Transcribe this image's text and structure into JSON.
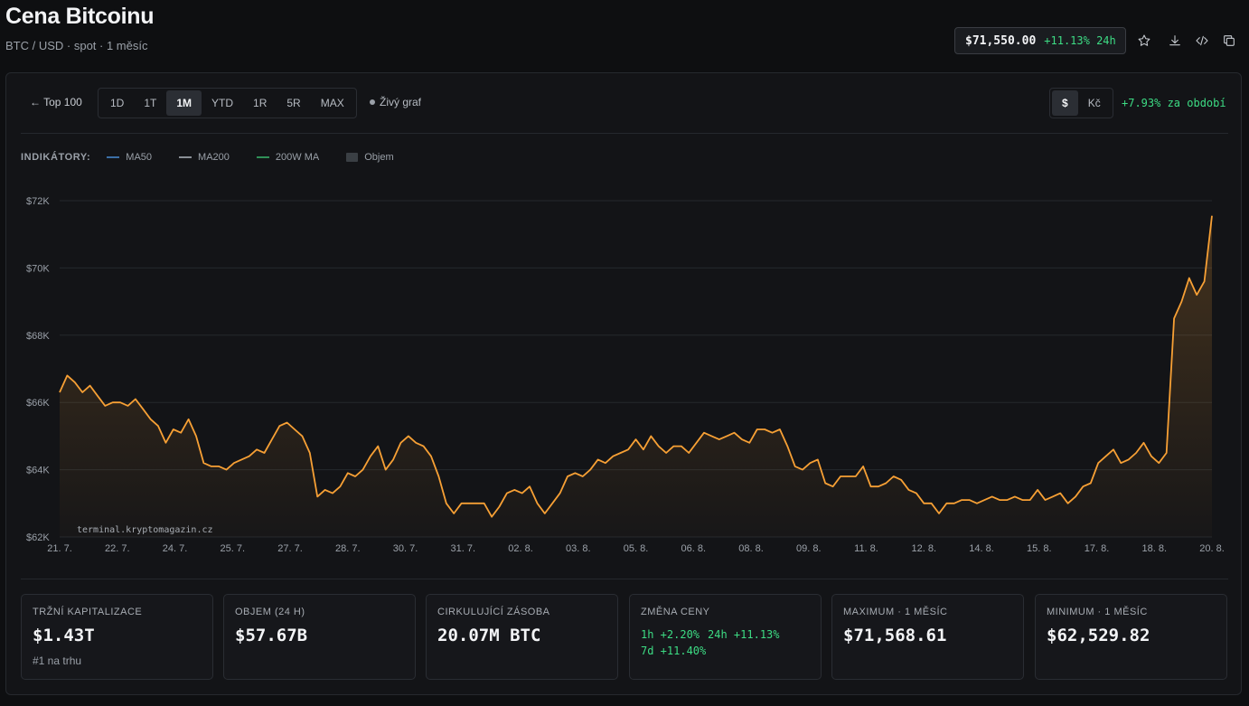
{
  "header": {
    "title": "Cena Bitcoinu",
    "subtitle": "BTC / USD · spot · 1 měsíc",
    "price": "$71,550.00",
    "price_change": "+11.13% 24h"
  },
  "toolbar": {
    "back_label": "← Top 100",
    "ranges": [
      "1D",
      "1T",
      "1M",
      "YTD",
      "1R",
      "5R",
      "MAX"
    ],
    "active_range": "1M",
    "live_label": "Živý graf",
    "currencies": [
      "$",
      "Kč"
    ],
    "active_currency": "$",
    "period_change": "+7.93% za období"
  },
  "indicators": {
    "label": "INDIKÁTORY:",
    "items": [
      {
        "name": "MA50",
        "color": "#3b6ea5"
      },
      {
        "name": "MA200",
        "color": "#8a8f96"
      },
      {
        "name": "200W MA",
        "color": "#2f8f57"
      },
      {
        "name": "Objem",
        "color": "#3a3f44"
      }
    ]
  },
  "colors": {
    "line": "#f7a035",
    "green": "#3ddc84",
    "grid": "#25282d"
  },
  "chart_data": {
    "type": "line",
    "y_ticks": [
      "$72K",
      "$70K",
      "$68K",
      "$66K",
      "$64K",
      "$62K"
    ],
    "ylim": [
      62000,
      72000
    ],
    "x_ticks": [
      "21. 7.",
      "22. 7.",
      "24. 7.",
      "25. 7.",
      "27. 7.",
      "28. 7.",
      "30. 7.",
      "31. 7.",
      "02. 8.",
      "03. 8.",
      "05. 8.",
      "06. 8.",
      "08. 8.",
      "09. 8.",
      "11. 8.",
      "12. 8.",
      "14. 8.",
      "15. 8.",
      "17. 8.",
      "18. 8.",
      "20. 8."
    ],
    "watermark": "terminal.kryptomagazin.cz",
    "series": [
      {
        "values": [
          66300,
          66800,
          66600,
          66300,
          66500,
          66200,
          65900,
          66000,
          66000,
          65900,
          66100,
          65800,
          65500,
          65300,
          64800,
          65200,
          65100,
          65500,
          65000,
          64200,
          64100,
          64100,
          64000,
          64200,
          64300,
          64400,
          64600,
          64500,
          64900,
          65300,
          65400,
          65200,
          65000,
          64500,
          63200,
          63400,
          63300,
          63500,
          63900,
          63800,
          64000,
          64400,
          64700,
          64000,
          64300,
          64800,
          65000,
          64800,
          64700,
          64400,
          63800,
          63000,
          62700,
          63000,
          63000,
          63000,
          63000,
          62600,
          62900,
          63300,
          63400,
          63300,
          63500,
          63000,
          62700,
          63000,
          63300,
          63800,
          63900,
          63800,
          64000,
          64300,
          64200,
          64400,
          64500,
          64600,
          64900,
          64600,
          65000,
          64700,
          64500,
          64700,
          64700,
          64500,
          64800,
          65100,
          65000,
          64900,
          65000,
          65100,
          64900,
          64800,
          65200,
          65200,
          65100,
          65200,
          64700,
          64100,
          64000,
          64200,
          64300,
          63600,
          63500,
          63800,
          63800,
          63800,
          64100,
          63500,
          63500,
          63600,
          63800,
          63700,
          63400,
          63300,
          63000,
          63000,
          62700,
          63000,
          63000,
          63100,
          63100,
          63000,
          63100,
          63200,
          63100,
          63100,
          63200,
          63100,
          63100,
          63400,
          63100,
          63200,
          63300,
          63000,
          63200,
          63500,
          63600,
          64200,
          64400,
          64600,
          64200,
          64300,
          64500,
          64800,
          64400,
          64200,
          64500,
          68500,
          69000,
          69700,
          69200,
          69600,
          71550
        ]
      }
    ]
  },
  "stats": [
    {
      "label": "TRŽNÍ KAPITALIZACE",
      "value": "$1.43T",
      "sub": "#1 na trhu"
    },
    {
      "label": "OBJEM (24 H)",
      "value": "$57.67B"
    },
    {
      "label": "CIRKULUJÍCÍ ZÁSOBA",
      "value": "20.07M BTC"
    },
    {
      "label": "ZMĚNA CENY",
      "changes": [
        "1h +2.20%",
        "24h +11.13%",
        "7d +11.40%"
      ]
    },
    {
      "label": "MAXIMUM · 1 MĚSÍC",
      "value": "$71,568.61"
    },
    {
      "label": "MINIMUM · 1 MĚSÍC",
      "value": "$62,529.82"
    }
  ]
}
